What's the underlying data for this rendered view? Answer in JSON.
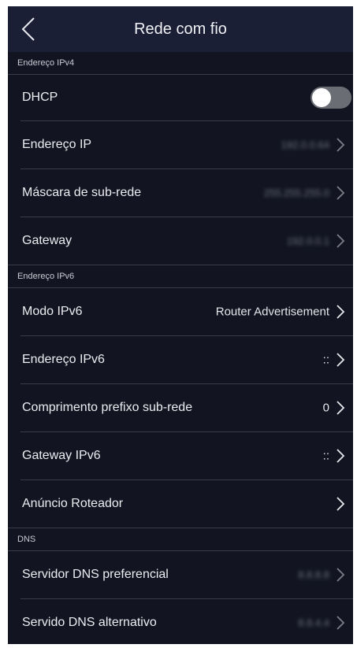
{
  "header": {
    "title": "Rede com fio",
    "back_icon": "chevron-left-icon"
  },
  "sections": {
    "ipv4": "Endereço IPv4",
    "ipv6": "Endereço IPv6",
    "dns": "DNS"
  },
  "ipv4": {
    "dhcp_label": "DHCP",
    "dhcp_enabled": false,
    "ip_label": "Endereço IP",
    "ip_value": "192.0.0.64",
    "mask_label": "Máscara de sub-rede",
    "mask_value": "255.255.255.0",
    "gateway_label": "Gateway",
    "gateway_value": "192.0.0.1"
  },
  "ipv6": {
    "mode_label": "Modo IPv6",
    "mode_value": "Router Advertisement",
    "address_label": "Endereço IPv6",
    "address_value": "::",
    "prefix_label": "Comprimento prefixo sub-rede",
    "prefix_value": "0",
    "gateway_label": "Gateway IPv6",
    "gateway_value": "::",
    "router_adv_label": "Anúncio Roteador"
  },
  "dns": {
    "preferred_label": "Servidor DNS preferencial",
    "preferred_value": "8.8.8.8",
    "alternate_label": "Servido DNS alternativo",
    "alternate_value": "8.8.4.4"
  },
  "colors": {
    "background": "#121521",
    "header": "#1b1f36",
    "divider": "#3a3d48",
    "toggle_off": "#6b6d74"
  }
}
